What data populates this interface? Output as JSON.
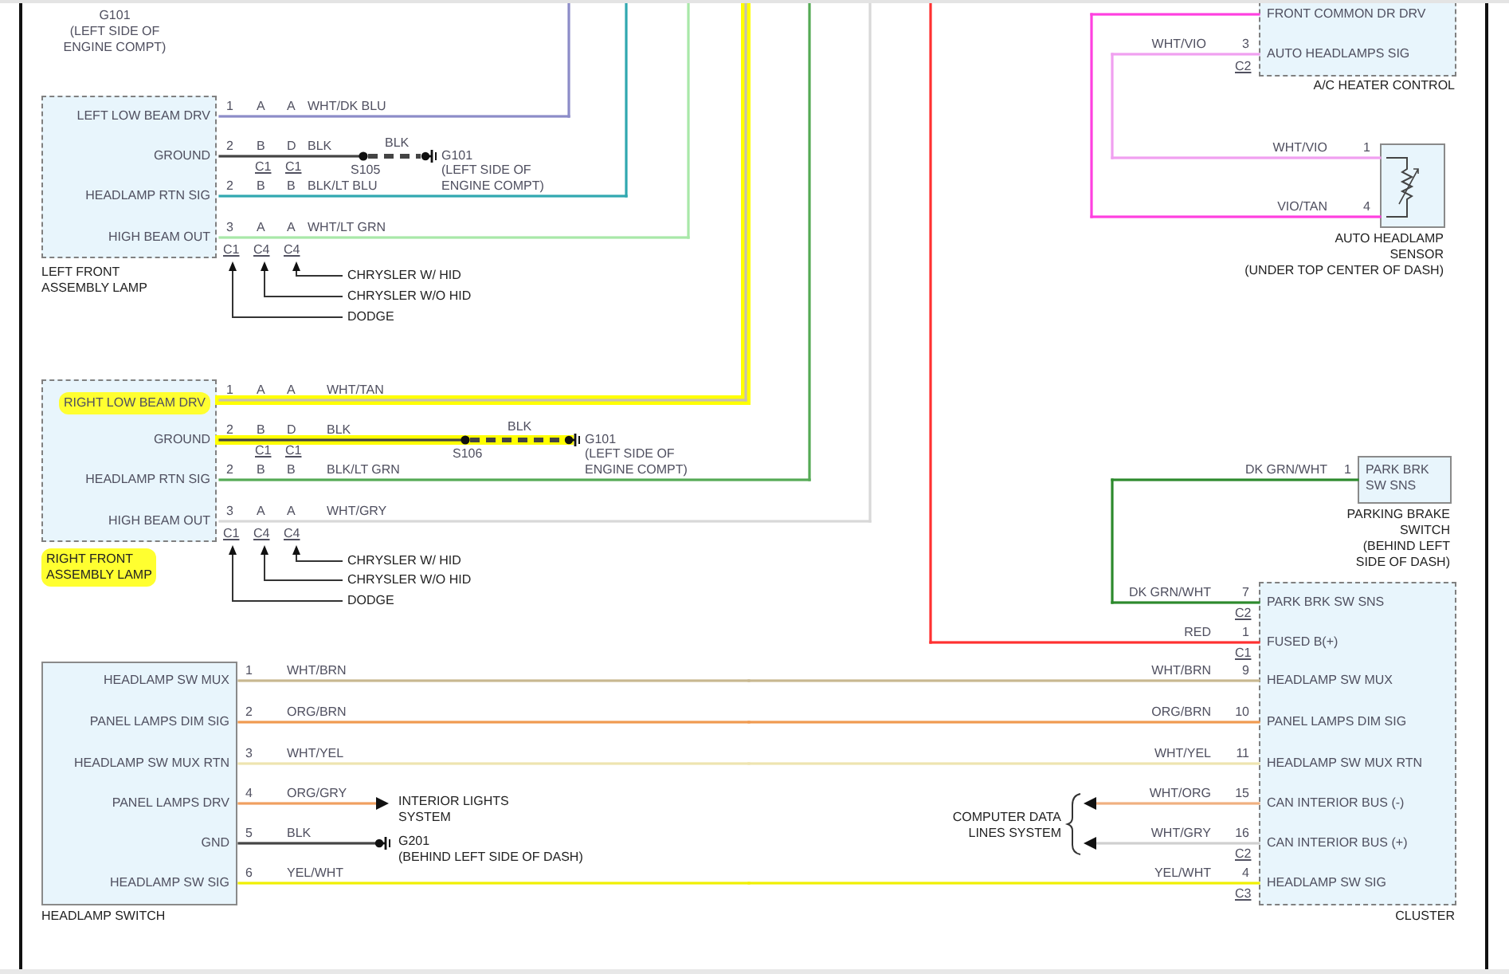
{
  "top_ground": {
    "label": "G101",
    "location": [
      "(LEFT SIDE OF",
      "ENGINE COMPT)"
    ]
  },
  "lamps": [
    {
      "name": [
        "LEFT FRONT",
        "ASSEMBLY LAMP"
      ],
      "highlighted": false,
      "pins": [
        {
          "label": "LEFT LOW BEAM DRV",
          "highlighted": false,
          "pin": "1",
          "cavities": [
            "A",
            "A"
          ],
          "wire": "WHT/DK BLU",
          "color": "#8c8cc8",
          "wire_highlighted": false
        },
        {
          "label": "GROUND",
          "highlighted": false,
          "pin": "2",
          "cavities": [
            "B",
            "D"
          ],
          "wire": "BLK",
          "color": "#444444",
          "wire_highlighted": false,
          "connectors": [
            "C1",
            "C1"
          ]
        },
        {
          "label": "HEADLAMP RTN SIG",
          "highlighted": false,
          "pin": "2",
          "cavities": [
            "B",
            "B"
          ],
          "wire": "BLK/LT BLU",
          "color": "#30a8b0",
          "wire_highlighted": false
        },
        {
          "label": "HIGH BEAM OUT",
          "highlighted": false,
          "pin": "3",
          "cavities": [
            "A",
            "A"
          ],
          "wire": "WHT/LT GRN",
          "color": "#a8e8a8",
          "wire_highlighted": false
        }
      ],
      "ground": {
        "splice": "S105",
        "wire": "BLK",
        "label": "G101",
        "location": [
          "(LEFT SIDE OF",
          "ENGINE COMPT)"
        ]
      },
      "connectors": [
        "C1",
        "C4",
        "C4"
      ],
      "variants": [
        "CHRYSLER W/ HID",
        "CHRYSLER W/O HID",
        "DODGE"
      ]
    },
    {
      "name": [
        "RIGHT FRONT",
        "ASSEMBLY LAMP"
      ],
      "highlighted": true,
      "pins": [
        {
          "label": "RIGHT LOW BEAM DRV",
          "highlighted": true,
          "pin": "1",
          "cavities": [
            "A",
            "A"
          ],
          "wire": "WHT/TAN",
          "color": "#c8c0b0",
          "wire_highlighted": true
        },
        {
          "label": "GROUND",
          "highlighted": false,
          "pin": "2",
          "cavities": [
            "B",
            "D"
          ],
          "wire": "BLK",
          "color": "#444444",
          "wire_highlighted": true,
          "connectors": [
            "C1",
            "C1"
          ]
        },
        {
          "label": "HEADLAMP RTN SIG",
          "highlighted": false,
          "pin": "2",
          "cavities": [
            "B",
            "B"
          ],
          "wire": "BLK/LT GRN",
          "color": "#55aa55",
          "wire_highlighted": false
        },
        {
          "label": "HIGH BEAM OUT",
          "highlighted": false,
          "pin": "3",
          "cavities": [
            "A",
            "A"
          ],
          "wire": "WHT/GRY",
          "color": "#d8d8d8",
          "wire_highlighted": false
        }
      ],
      "ground": {
        "splice": "S106",
        "wire": "BLK",
        "label": "G101",
        "location": [
          "(LEFT SIDE OF",
          "ENGINE COMPT)"
        ]
      },
      "connectors": [
        "C1",
        "C4",
        "C4"
      ],
      "variants": [
        "CHRYSLER W/ HID",
        "CHRYSLER W/O HID",
        "DODGE"
      ]
    }
  ],
  "ac_heater_control": {
    "name": "A/C HEATER CONTROL",
    "pins": [
      {
        "label": "FRONT COMMON DR DRV"
      },
      {
        "label": "AUTO HEADLAMPS SIG",
        "pin": "3",
        "wire": "WHT/VIO",
        "connector": "C2"
      }
    ]
  },
  "auto_headlamp_sensor": {
    "caption": [
      "AUTO HEADLAMP",
      "SENSOR",
      "(UNDER TOP CENTER OF DASH)"
    ],
    "pins": [
      {
        "pin": "1",
        "wire": "WHT/VIO",
        "color": "#f0a0f0"
      },
      {
        "pin": "4",
        "wire": "VIO/TAN",
        "color": "#ff40e0"
      }
    ]
  },
  "parking_brake_switch": {
    "box": [
      "PARK BRK",
      "SW SNS"
    ],
    "pin": "1",
    "wire": "DK GRN/WHT",
    "caption": [
      "PARKING BRAKE",
      "SWITCH",
      "(BEHIND LEFT",
      "SIDE OF DASH)"
    ]
  },
  "cluster": {
    "name": "CLUSTER",
    "pins": [
      {
        "kind": "branch",
        "label": "PARK BRK SW SNS",
        "pin": "7",
        "wire": "DK GRN/WHT",
        "color": "#2d8a2d",
        "connector": "C2"
      },
      {
        "kind": "supply",
        "label": "FUSED B(+)",
        "pin": "1",
        "wire": "RED",
        "color": "#ff3030",
        "connector": "C1"
      },
      {
        "kind": "through",
        "label": "HEADLAMP SW MUX",
        "pin": "9",
        "wire": "WHT/BRN",
        "color": "#c8b890"
      },
      {
        "kind": "through",
        "label": "PANEL LAMPS DIM SIG",
        "pin": "10",
        "wire": "ORG/BRN",
        "color": "#f09a50"
      },
      {
        "kind": "through",
        "label": "HEADLAMP SW MUX RTN",
        "pin": "11",
        "wire": "WHT/YEL",
        "color": "#eee4b0"
      },
      {
        "kind": "bus",
        "label": "CAN INTERIOR BUS (-)",
        "pin": "15",
        "wire": "WHT/ORG",
        "color": "#f0b080"
      },
      {
        "kind": "bus",
        "label": "CAN INTERIOR BUS (+)",
        "pin": "16",
        "wire": "WHT/GRY",
        "color": "#d0d0d0",
        "connector": "C2"
      },
      {
        "kind": "through",
        "label": "HEADLAMP SW SIG",
        "pin": "4",
        "wire": "YEL/WHT",
        "color": "#f0f000",
        "connector": "C3"
      }
    ]
  },
  "data_lines": {
    "label": [
      "COMPUTER DATA",
      "LINES SYSTEM"
    ]
  },
  "headlamp_switch": {
    "name": "HEADLAMP SWITCH",
    "pins": [
      {
        "kind": "through",
        "label": "HEADLAMP SW MUX",
        "pin": "1",
        "wire": "WHT/BRN",
        "color": "#c8b890"
      },
      {
        "kind": "through",
        "label": "PANEL LAMPS DIM SIG",
        "pin": "2",
        "wire": "ORG/BRN",
        "color": "#f09a50"
      },
      {
        "kind": "through",
        "label": "HEADLAMP SW MUX RTN",
        "pin": "3",
        "wire": "WHT/YEL",
        "color": "#eee4b0"
      },
      {
        "kind": "arrow",
        "label": "PANEL LAMPS DRV",
        "pin": "4",
        "wire": "ORG/GRY",
        "color": "#f0a060",
        "target": [
          "INTERIOR LIGHTS",
          "SYSTEM"
        ]
      },
      {
        "kind": "ground",
        "label": "GND",
        "pin": "5",
        "wire": "BLK",
        "color": "#444444",
        "target": [
          "G201",
          "(BEHIND LEFT SIDE OF DASH)"
        ]
      },
      {
        "kind": "through",
        "label": "HEADLAMP SW SIG",
        "pin": "6",
        "wire": "YEL/WHT",
        "color": "#f0f000"
      }
    ]
  }
}
